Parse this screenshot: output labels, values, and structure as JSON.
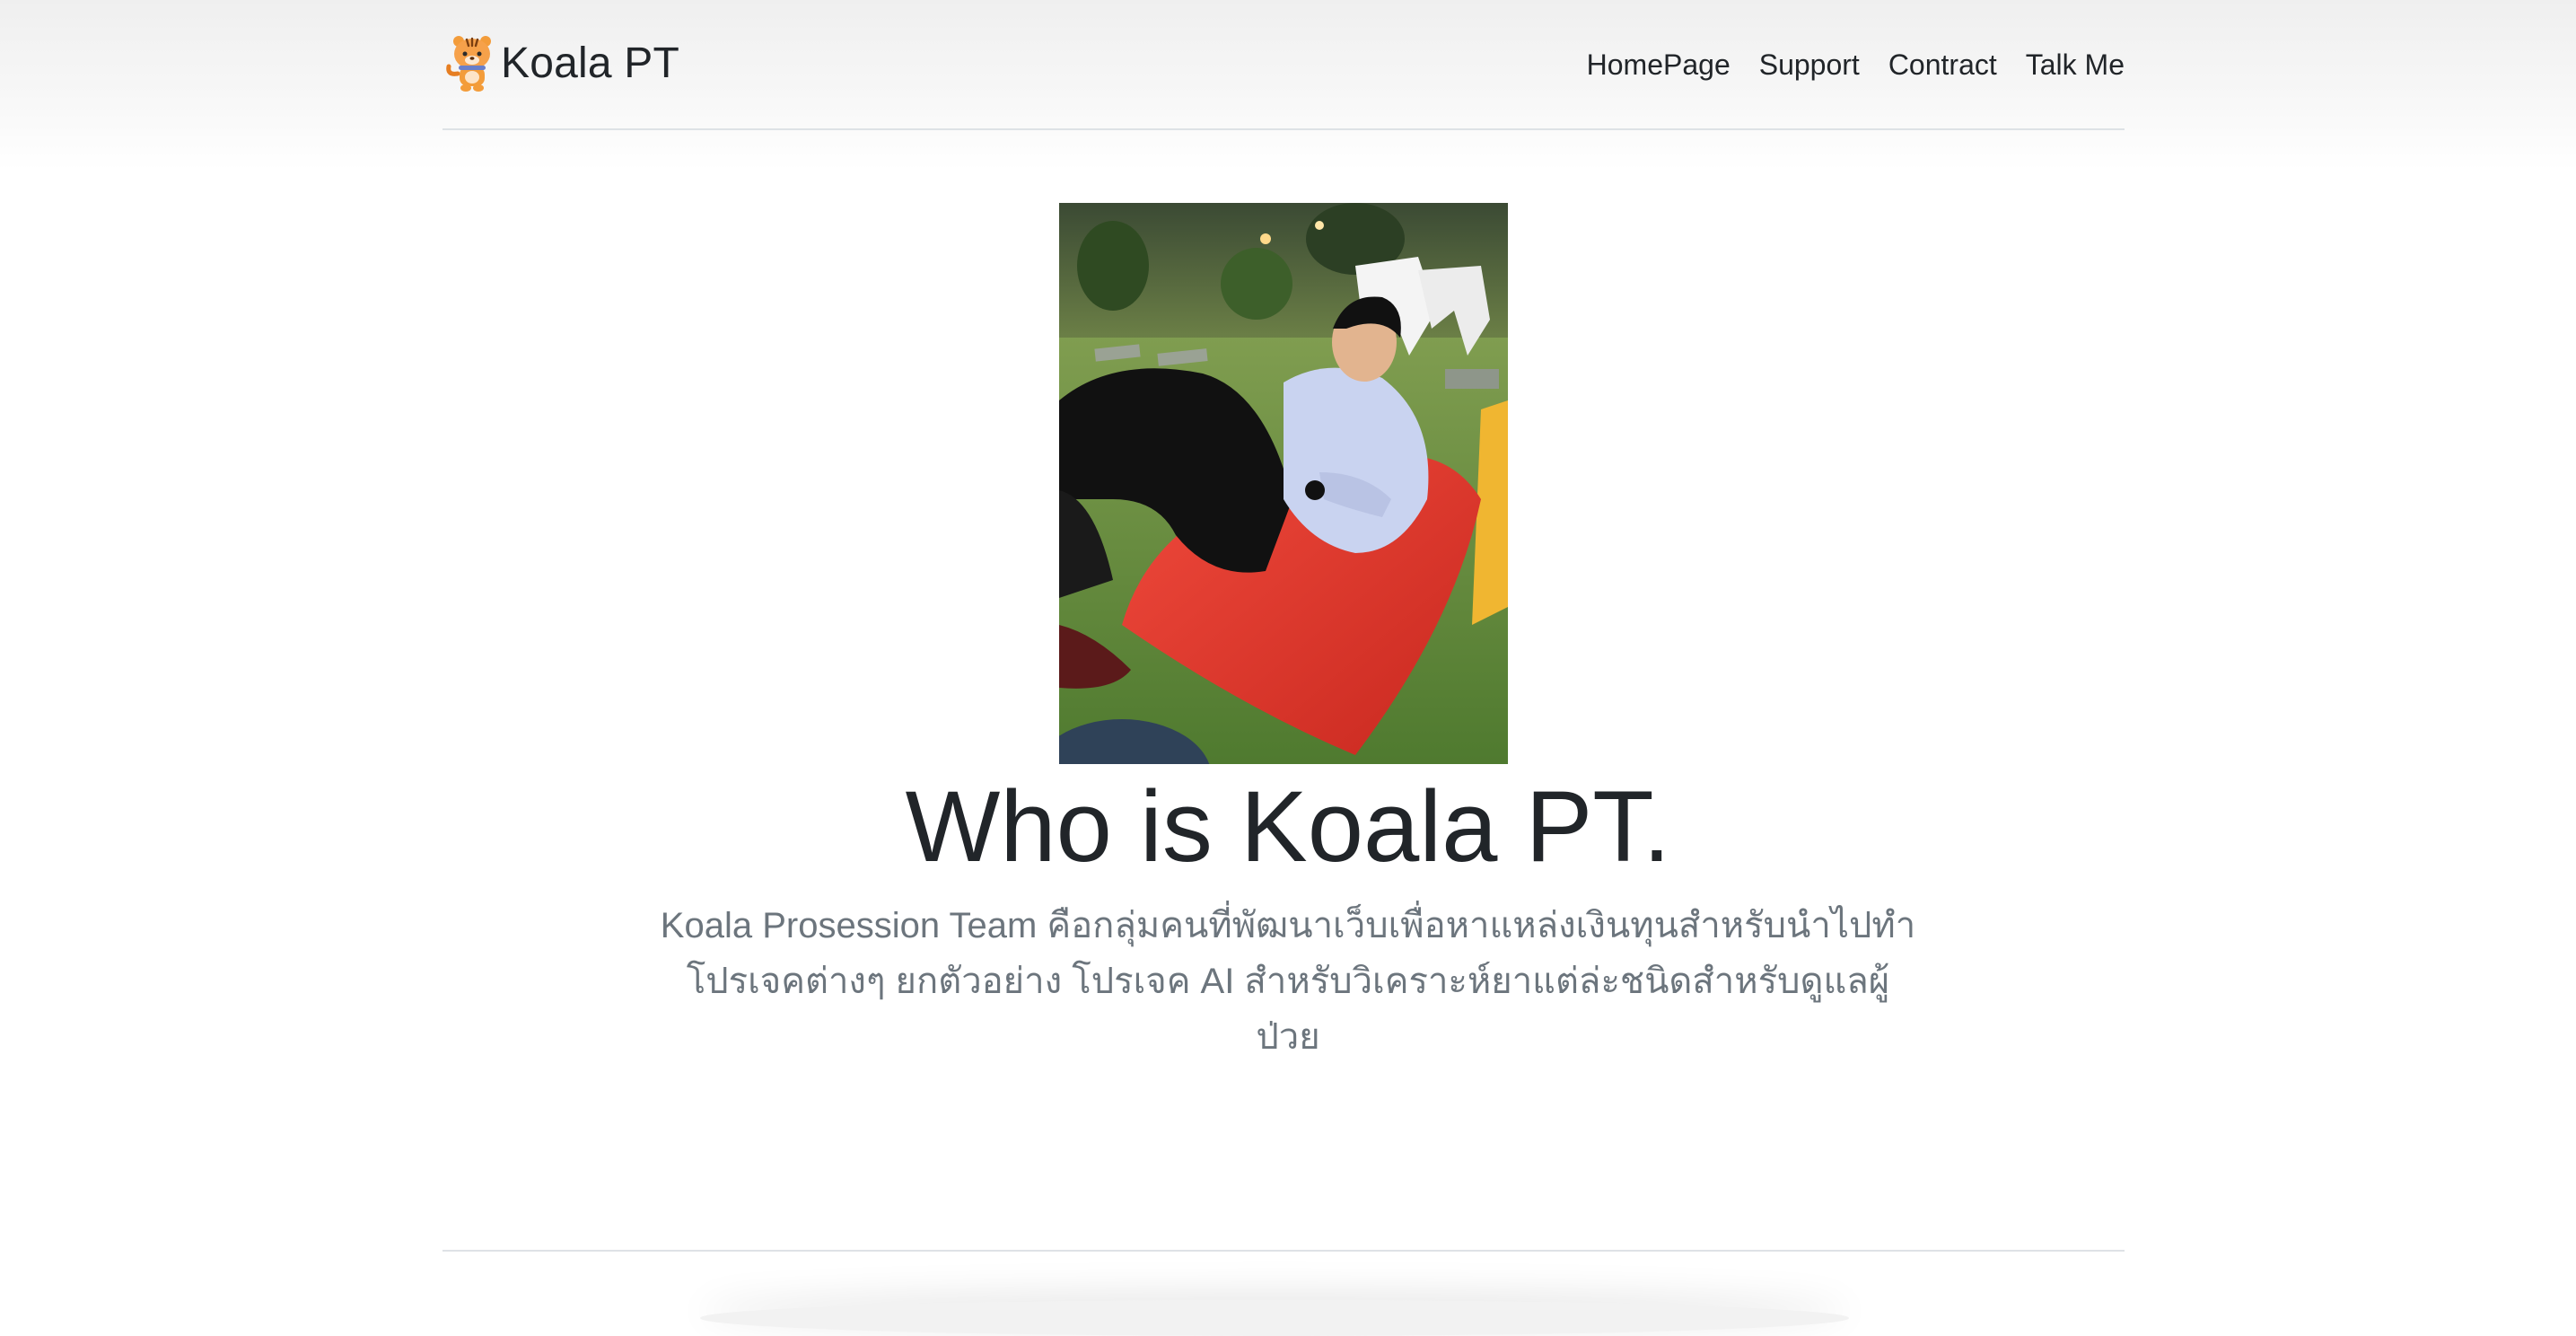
{
  "header": {
    "brand": "Koala PT",
    "nav": [
      "HomePage",
      "Support",
      "Contract",
      "Talk Me"
    ]
  },
  "hero": {
    "title": "Who is Koala PT.",
    "lead_line1": "Koala Prosession Team คือกลุ่มคนที่พัฒนาเว็บเพื่อหาแหล่งเงินทุนสำหรับนำไปทำ",
    "lead_line2": "โปรเจคต่างๆ ยกตัวอย่าง โปรเจค AI สำหรับวิเคราะห์ยาแต่ล่ะชนิดสำหรับดูแลผู้ป่วย"
  },
  "icons": {
    "logo": "tiger-mascot-icon"
  },
  "colors": {
    "text": "#212529",
    "muted": "#6c757d",
    "border": "#dee2e6"
  }
}
